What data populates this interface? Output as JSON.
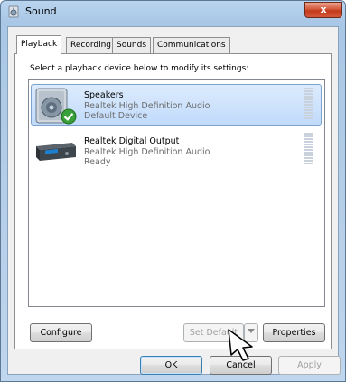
{
  "window": {
    "title": "Sound",
    "close_label": "x"
  },
  "tabs": [
    {
      "label": "Playback",
      "active": true
    },
    {
      "label": "Recording",
      "active": false
    },
    {
      "label": "Sounds",
      "active": false
    },
    {
      "label": "Communications",
      "active": false
    }
  ],
  "playback": {
    "instruction": "Select a playback device below to modify its settings:",
    "devices": [
      {
        "name": "Speakers",
        "driver": "Realtek High Definition Audio",
        "status": "Default Device",
        "icon": "speaker-icon",
        "selected": true,
        "is_default": true
      },
      {
        "name": "Realtek Digital Output",
        "driver": "Realtek High Definition Audio",
        "status": "Ready",
        "icon": "digital-output-icon",
        "selected": false,
        "is_default": false
      }
    ],
    "buttons": {
      "configure": "Configure",
      "set_default": "Set Default",
      "properties": "Properties"
    }
  },
  "dialog_buttons": {
    "ok": "OK",
    "cancel": "Cancel",
    "apply": "Apply"
  },
  "colors": {
    "selection": "#c1dbfc",
    "default_check": "#3aa03a",
    "close_button": "#c23a1c"
  }
}
